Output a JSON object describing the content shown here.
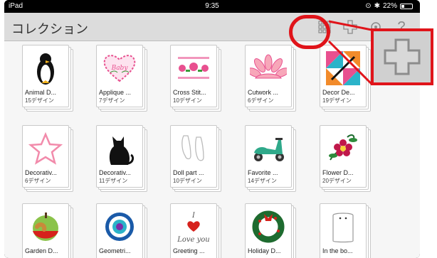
{
  "status_bar": {
    "device": "iPad",
    "time": "9:35",
    "battery": "22%"
  },
  "nav": {
    "title": "コレクション",
    "icons": [
      "grid-view-icon",
      "add-icon",
      "settings-icon",
      "help-icon"
    ]
  },
  "collections": [
    {
      "name": "Animal D...",
      "count": "15デザイン",
      "icon": "penguin"
    },
    {
      "name": "Applique ...",
      "count": "7デザイン",
      "icon": "heart-baby"
    },
    {
      "name": "Cross Stit...",
      "count": "10デザイン",
      "icon": "cross-stitch-floral"
    },
    {
      "name": "Cutwork ...",
      "count": "6デザイン",
      "icon": "cutwork-fan"
    },
    {
      "name": "Decor De...",
      "count": "19デザイン",
      "icon": "quilt-block"
    },
    {
      "name": "Decorativ...",
      "count": "6デザイン",
      "icon": "star-outline"
    },
    {
      "name": "Decorativ...",
      "count": "11デザイン",
      "icon": "black-cat"
    },
    {
      "name": "Doll part ...",
      "count": "10デザイン",
      "icon": "doll-parts"
    },
    {
      "name": "Favorite ...",
      "count": "14デザイン",
      "icon": "scooter"
    },
    {
      "name": "Flower D...",
      "count": "20デザイン",
      "icon": "flower"
    },
    {
      "name": "Garden D...",
      "count": "",
      "icon": "apple-worm"
    },
    {
      "name": "Geometri...",
      "count": "",
      "icon": "geometric-circle"
    },
    {
      "name": "Greeting ...",
      "count": "",
      "icon": "love-you-card"
    },
    {
      "name": "Holiday D...",
      "count": "",
      "icon": "wreath"
    },
    {
      "name": "In the bo...",
      "count": "",
      "icon": "bag"
    }
  ],
  "greeting_thumb_text": {
    "top": "I",
    "bottom": "Love you"
  },
  "colors": {
    "highlight": "#e0141a",
    "nav_bg": "#dcdcdc",
    "content_bg": "#f6f6f6"
  }
}
